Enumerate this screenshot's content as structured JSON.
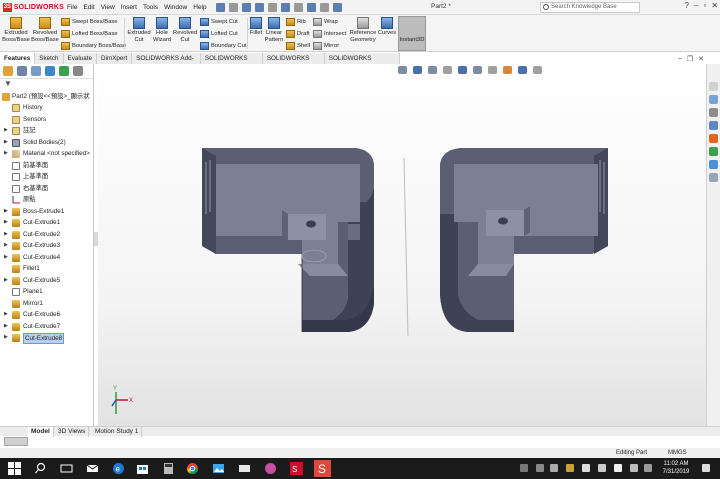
{
  "app": {
    "brand": "SOLIDWORKS",
    "doc_title": "Part2 *",
    "menu": [
      "File",
      "Edit",
      "View",
      "Insert",
      "Tools",
      "Window",
      "Help"
    ],
    "search_placeholder": "Search Knowledge Base"
  },
  "ribbon": {
    "extruded_boss_l1": "Extruded",
    "extruded_boss_l2": "Boss/Base",
    "revolved_boss_l1": "Revolved",
    "revolved_boss_l2": "Boss/Base",
    "swept_boss": "Swept Boss/Base",
    "lofted_boss": "Lofted Boss/Base",
    "boundary_boss": "Boundary Boss/Base",
    "extruded_cut_l1": "Extruded",
    "extruded_cut_l2": "Cut",
    "hole_wizard_l1": "Hole",
    "hole_wizard_l2": "Wizard",
    "revolved_cut_l1": "Revolved",
    "revolved_cut_l2": "Cut",
    "swept_cut": "Swept Cut",
    "lofted_cut": "Lofted Cut",
    "boundary_cut": "Boundary Cut",
    "fillet": "Fillet",
    "linear_pattern_l1": "Linear",
    "linear_pattern_l2": "Pattern",
    "rib": "Rib",
    "draft": "Draft",
    "shell": "Shell",
    "wrap": "Wrap",
    "intersect": "Intersect",
    "mirror": "Mirror",
    "reference_geometry_l1": "Reference",
    "reference_geometry_l2": "Geometry",
    "curves": "Curves",
    "instant3d": "Instant3D"
  },
  "command_tabs": [
    "Features",
    "Sketch",
    "Evaluate",
    "DimXpert",
    "SOLIDWORKS Add-Ins",
    "SOLIDWORKS MBD",
    "SOLIDWORKS CAM",
    "SOLIDWORKS Inspection"
  ],
  "tree": {
    "root": "Part2 (預設<<預設>_顯示狀",
    "items": [
      {
        "label": "History",
        "icon": "folder-icon"
      },
      {
        "label": "Sensors",
        "icon": "folder-icon"
      },
      {
        "label": "註記",
        "icon": "annotation-icon"
      },
      {
        "label": "Solid Bodies(2)",
        "icon": "solid-bodies-icon"
      },
      {
        "label": "Material <not specified>",
        "icon": "material-icon"
      },
      {
        "label": "前基準面",
        "icon": "plane-icon"
      },
      {
        "label": "上基準面",
        "icon": "plane-icon"
      },
      {
        "label": "右基準面",
        "icon": "plane-icon"
      },
      {
        "label": "原點",
        "icon": "origin-icon"
      },
      {
        "label": "Boss-Extrude1",
        "icon": "feature-icon"
      },
      {
        "label": "Cut-Extrude1",
        "icon": "feature-icon"
      },
      {
        "label": "Cut-Extrude2",
        "icon": "feature-icon"
      },
      {
        "label": "Cut-Extrude3",
        "icon": "feature-icon"
      },
      {
        "label": "Cut-Extrude4",
        "icon": "feature-icon"
      },
      {
        "label": "Fillet1",
        "icon": "feature-icon"
      },
      {
        "label": "Cut-Extrude5",
        "icon": "feature-icon"
      },
      {
        "label": "Plane1",
        "icon": "plane-icon"
      },
      {
        "label": "Mirror1",
        "icon": "feature-icon"
      },
      {
        "label": "Cut-Extrude6",
        "icon": "feature-icon"
      },
      {
        "label": "Cut-Extrude7",
        "icon": "feature-icon"
      },
      {
        "label": "Cut-Extrude8",
        "icon": "feature-icon"
      }
    ]
  },
  "triad": {
    "x": "X",
    "y": "Y"
  },
  "bottom_tabs": [
    "Model",
    "3D Views",
    "Motion Study 1"
  ],
  "status": {
    "mode": "Editing Part",
    "units": "MMGS"
  },
  "clock": {
    "time": "11:02 AM",
    "date": "7/31/2019"
  },
  "colors": {
    "accent": "#c8102e",
    "part": "#6e7185",
    "selection": "#b8d0ee"
  }
}
